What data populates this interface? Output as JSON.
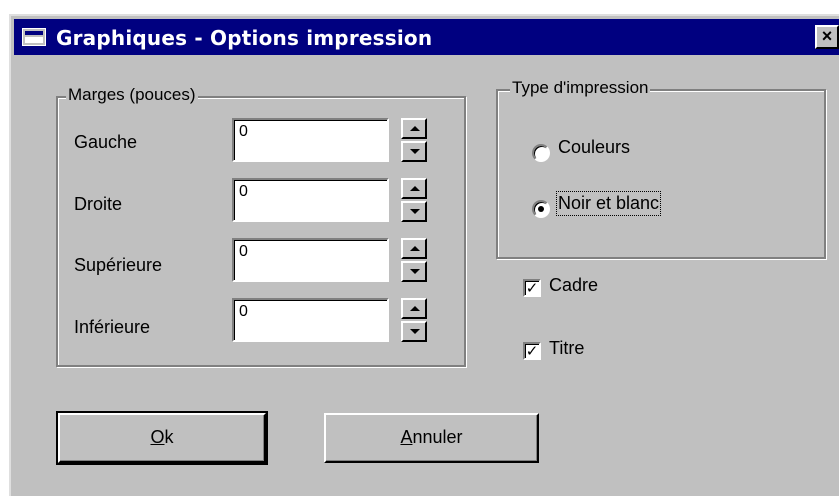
{
  "window": {
    "title": "Graphiques - Options impression",
    "close_label": "×"
  },
  "margins": {
    "legend": "Marges (pouces)",
    "rows": [
      {
        "label": "Gauche",
        "value": "0"
      },
      {
        "label": "Droite",
        "value": "0"
      },
      {
        "label": "Supérieure",
        "value": "0"
      },
      {
        "label": "Inférieure",
        "value": "0"
      }
    ]
  },
  "print_type": {
    "legend": "Type d'impression",
    "options": [
      {
        "label": "Couleurs",
        "selected": false
      },
      {
        "label": "Noir et blanc",
        "selected": true
      }
    ]
  },
  "checkboxes": [
    {
      "label": "Cadre",
      "checked": true
    },
    {
      "label": "Titre",
      "checked": true
    }
  ],
  "buttons": {
    "ok": {
      "mnemonic": "O",
      "rest": "k"
    },
    "cancel": {
      "mnemonic": "A",
      "rest": "nnuler"
    }
  },
  "colors": {
    "titlebar": "#000080",
    "face": "#c0c0c0"
  },
  "icons": {
    "title": "window-icon",
    "spin_up": "arrow-up-icon",
    "spin_down": "arrow-down-icon",
    "close": "close-icon"
  }
}
